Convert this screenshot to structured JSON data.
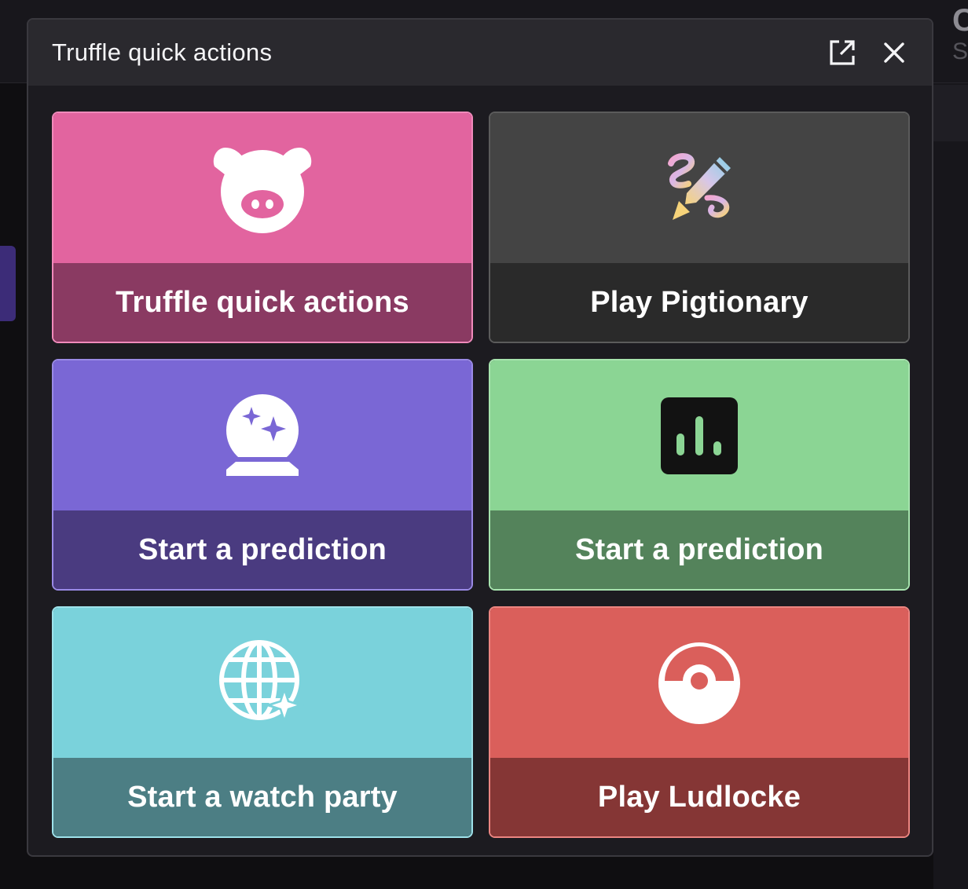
{
  "modal": {
    "title": "Truffle quick actions",
    "actions": [
      {
        "name": "open-external",
        "icon": "external-link-icon"
      },
      {
        "name": "close",
        "icon": "close-icon"
      }
    ]
  },
  "cards": [
    {
      "label": "Truffle quick actions",
      "icon": "pig-icon",
      "color": "#e2649f"
    },
    {
      "label": "Play Pigtionary",
      "icon": "pencil-scribble-icon",
      "color": "#444444"
    },
    {
      "label": "Start a prediction",
      "icon": "crystal-ball-icon",
      "color": "#7a67d5"
    },
    {
      "label": "Start a prediction",
      "icon": "bar-chart-icon",
      "color": "#8bd594"
    },
    {
      "label": "Start a watch party",
      "icon": "globe-sparkle-icon",
      "color": "#7ad2db"
    },
    {
      "label": "Play Ludlocke",
      "icon": "pokeball-icon",
      "color": "#da5f5b"
    }
  ],
  "background": {
    "peek_letter": "C",
    "peek_sub": "S"
  }
}
